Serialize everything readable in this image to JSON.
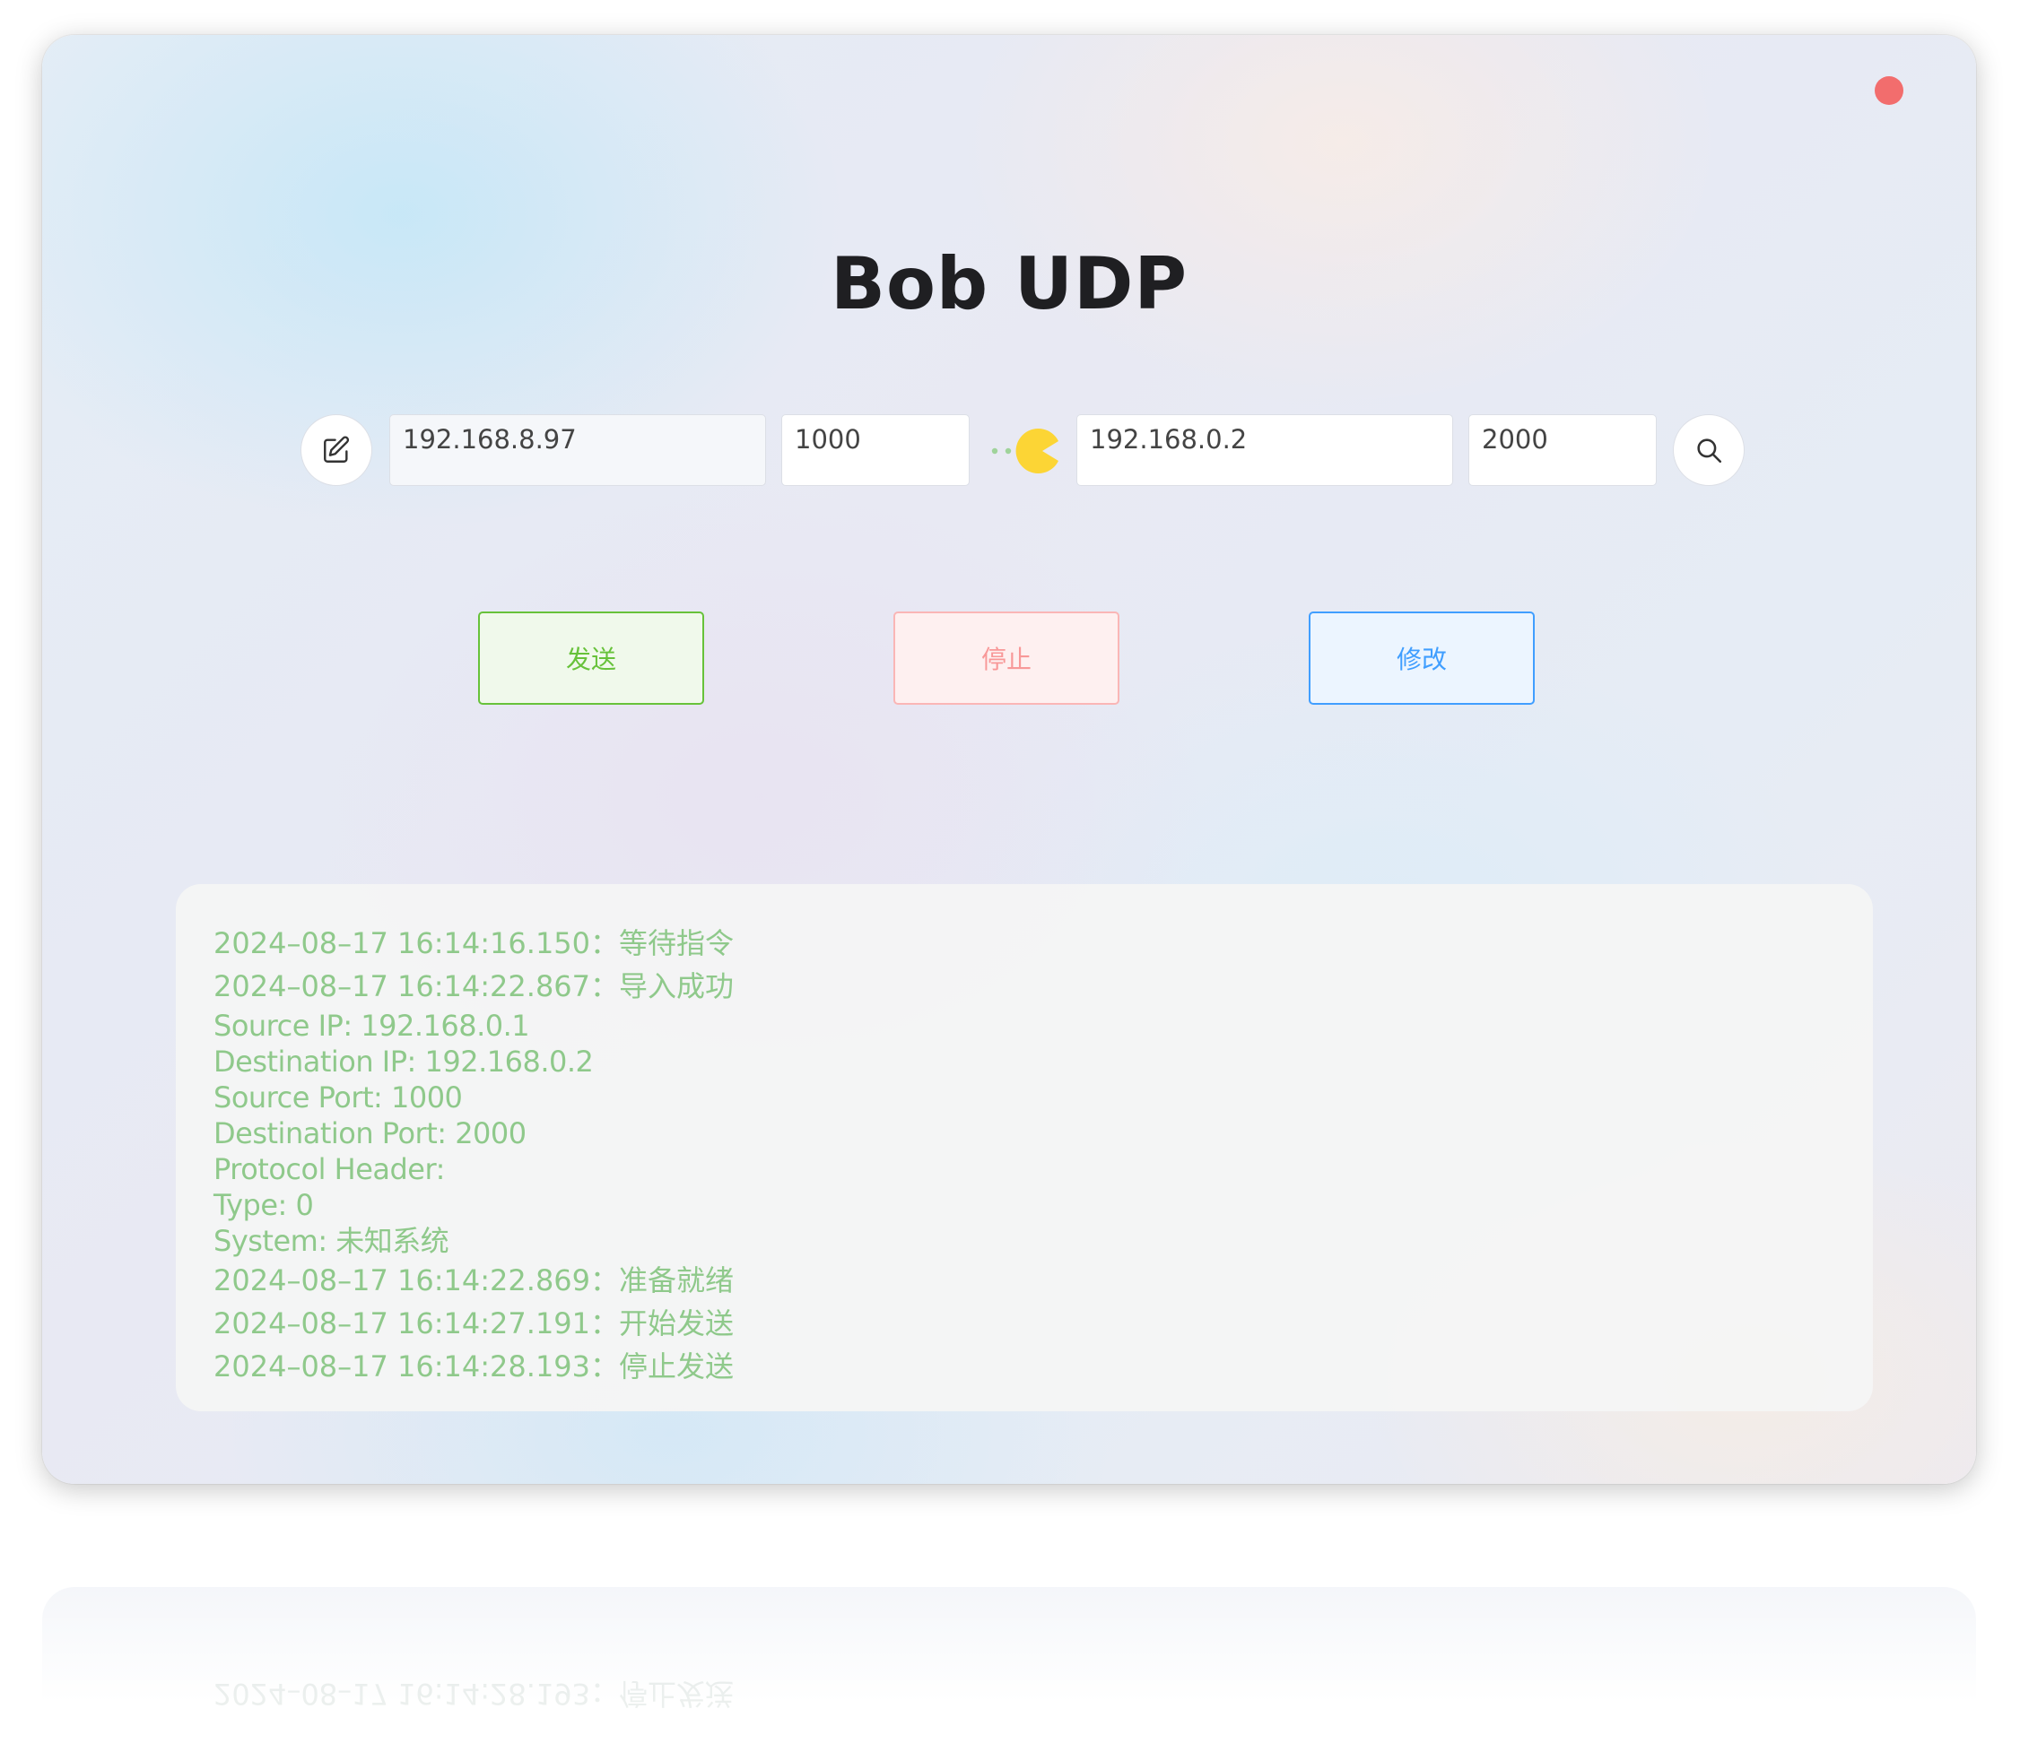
{
  "app": {
    "title": "Bob UDP"
  },
  "connection": {
    "source_ip": "192.168.8.97",
    "source_port": "1000",
    "dest_ip": "192.168.0.2",
    "dest_port": "2000"
  },
  "actions": {
    "send_label": "发送",
    "stop_label": "停止",
    "modify_label": "修改"
  },
  "icons": {
    "edit": "edit-icon",
    "search": "search-icon",
    "pacman": "pacman-icon",
    "close": "close-dot"
  },
  "colors": {
    "success": "#67c23a",
    "danger": "#f89898",
    "primary": "#409eff",
    "log_text": "#8fc98b",
    "close_dot": "#f26d6d",
    "pacman": "#fcd535"
  },
  "log": {
    "lines": [
      "2024–08–17 16:14:16.150：等待指令",
      "2024–08–17 16:14:22.867：导入成功"
    ],
    "details": [
      "Source IP: 192.168.0.1",
      "Destination IP: 192.168.0.2",
      "Source Port: 1000",
      "Destination Port: 2000",
      "Protocol Header:",
      "Type: 0",
      "System: 未知系统"
    ],
    "lines_after": [
      "2024–08–17 16:14:22.869：准备就绪",
      "2024–08–17 16:14:27.191：开始发送",
      "2024–08–17 16:14:28.193：停止发送"
    ]
  }
}
